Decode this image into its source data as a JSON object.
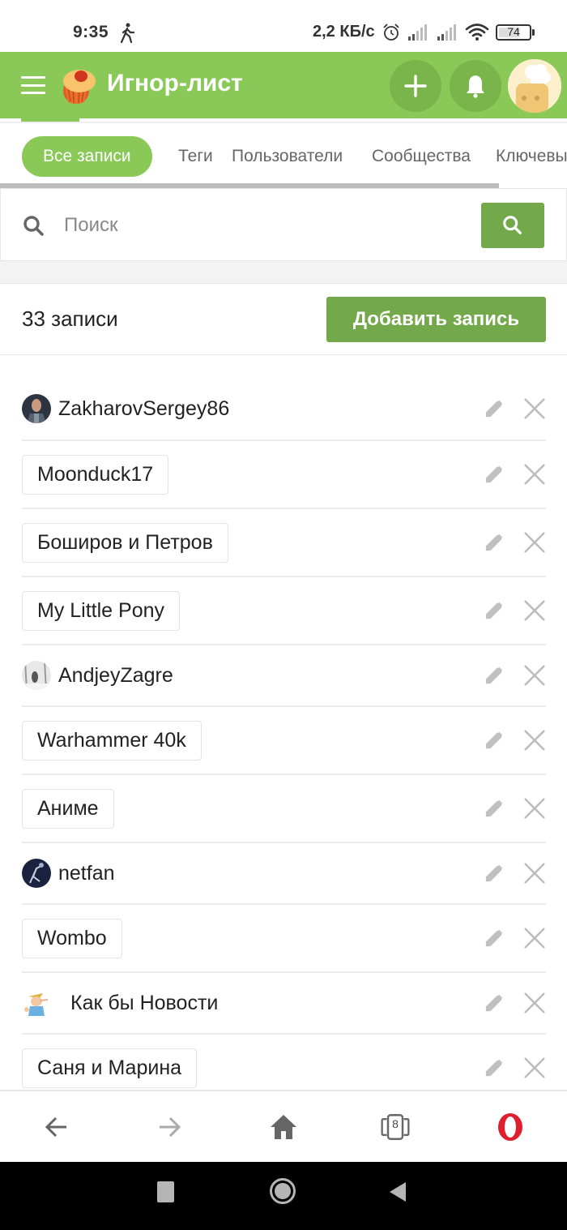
{
  "status_bar": {
    "time": "9:35",
    "network_speed": "2,2 КБ/с",
    "battery_level": "74",
    "battery_percent": 74,
    "icons": [
      "walking-icon",
      "alarm-icon",
      "signal-icon",
      "signal-icon",
      "wifi-icon",
      "battery-icon"
    ]
  },
  "header": {
    "title": "Игнор-лист",
    "menu_icon": "hamburger-icon",
    "add_icon": "plus-icon",
    "notifications_icon": "bell-icon",
    "accent_color": "#8ac858"
  },
  "tabs": [
    {
      "label": "Все записи",
      "active": true
    },
    {
      "label": "Теги",
      "active": false
    },
    {
      "label": "Пользователи",
      "active": false
    },
    {
      "label": "Сообщества",
      "active": false
    },
    {
      "label": "Ключевые слова",
      "active": false
    }
  ],
  "search": {
    "placeholder": "Поиск",
    "value": ""
  },
  "summary": {
    "count_label": "33 записи",
    "add_button_label": "Добавить запись",
    "button_color": "#73a84b"
  },
  "entries": [
    {
      "label": "ZakharovSergey86",
      "type": "user",
      "avatar": "photo-dark"
    },
    {
      "label": "Moonduck17",
      "type": "tag"
    },
    {
      "label": "Боширов и Петров",
      "type": "tag"
    },
    {
      "label": "My Little Pony",
      "type": "tag"
    },
    {
      "label": "AndjeyZagre",
      "type": "user",
      "avatar": "photo-snow"
    },
    {
      "label": "Warhammer 40k",
      "type": "tag"
    },
    {
      "label": "Аниме",
      "type": "tag"
    },
    {
      "label": "netfan",
      "type": "user",
      "avatar": "photo-space"
    },
    {
      "label": "Wombo",
      "type": "tag"
    },
    {
      "label": "Как бы Новости",
      "type": "community",
      "avatar": "pinocchio"
    },
    {
      "label": "Саня и Марина",
      "type": "tag"
    }
  ],
  "browser_nav": {
    "tab_count": "8",
    "buttons": [
      "back-arrow-icon",
      "forward-arrow-icon",
      "home-icon",
      "tabs-icon",
      "opera-menu-icon"
    ]
  },
  "system_nav": [
    "recents-icon",
    "home-circle-icon",
    "back-triangle-icon"
  ]
}
